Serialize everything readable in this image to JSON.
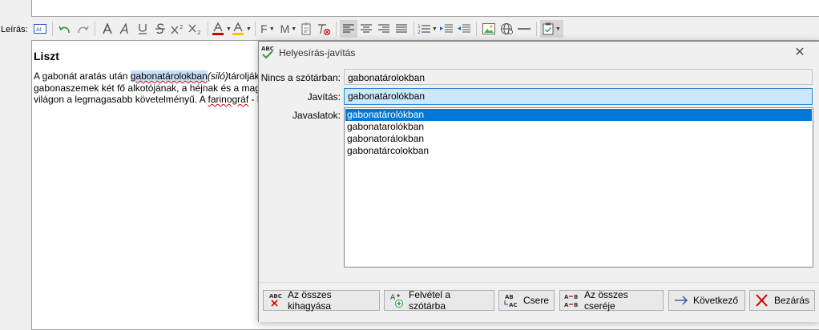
{
  "editor_field_label": "Leírás:",
  "toolbar": {
    "font_color_letter": "A",
    "format_f": "F",
    "format_m": "M"
  },
  "document": {
    "title": "Liszt",
    "line1_pre": "A gabonát aratás után ",
    "line1_highlight": "gabonatárolokban",
    "line1_italic": "(siló)",
    "line1_post": "tárolják",
    "line2": "gabonaszemek két fő alkotójának, a héjnak és a mag",
    "line3_pre": "világon a legmagasabb követelményű. A ",
    "line3_word": "farinográf",
    "line3_post": " - l"
  },
  "dialog": {
    "title": "Helyesírás-javítás",
    "not_in_dict_label": "Nincs a szótárban:",
    "not_in_dict_value": "gabonatárolokban",
    "correction_label": "Javítás:",
    "correction_value": "gabonatárolókban",
    "suggestions_label": "Javaslatok:",
    "suggestions": [
      "gabonatárolókban",
      "gabonatarolókban",
      "gabonatorálokban",
      "gabonatárcolokban"
    ],
    "selected_suggestion_index": 0,
    "buttons": {
      "ignore_all": "Az összes kihagyása",
      "add_to_dict": "Felvétel a szótárba",
      "replace": "Csere",
      "replace_all": "Az összes cseréje",
      "next": "Következő",
      "close": "Bezárás"
    }
  },
  "colors": {
    "selection": "#0078d7",
    "correction_bg": "#cce8ff",
    "highlight": "#c6def7",
    "spell_error": "#d00000"
  }
}
